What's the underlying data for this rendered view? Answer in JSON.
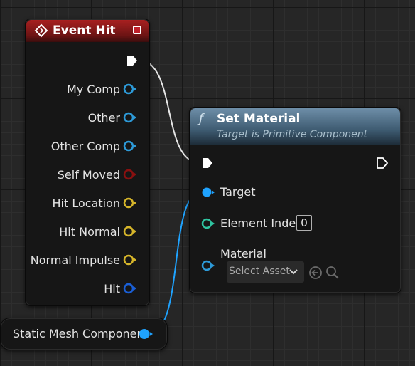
{
  "event_node": {
    "title": "Event Hit",
    "header_color": "#a82020",
    "pins": [
      {
        "label": "My Comp",
        "type": "object",
        "color": "#2d9ad8"
      },
      {
        "label": "Other",
        "type": "object",
        "color": "#2d9ad8"
      },
      {
        "label": "Other Comp",
        "type": "object",
        "color": "#2d9ad8"
      },
      {
        "label": "Self Moved",
        "type": "bool",
        "color": "#8a1010"
      },
      {
        "label": "Hit Location",
        "type": "vector",
        "color": "#d6b52a"
      },
      {
        "label": "Hit Normal",
        "type": "vector",
        "color": "#d6b52a"
      },
      {
        "label": "Normal Impulse",
        "type": "vector",
        "color": "#d6b52a"
      },
      {
        "label": "Hit",
        "type": "struct",
        "color": "#1a5fd6"
      }
    ]
  },
  "function_node": {
    "title": "Set Material",
    "subtitle": "Target is Primitive Component",
    "icon": "function-icon",
    "header_color": "#4a6a82",
    "pins": {
      "target": "Target",
      "element_index": "Element Index",
      "element_index_value": "0",
      "material": "Material",
      "material_placeholder": "Select Asset"
    }
  },
  "variable_node": {
    "label": "Static Mesh Component",
    "color": "#1fa3ff"
  },
  "wire_colors": {
    "exec": "#e6e6e6",
    "object": "#1fa3ff"
  }
}
